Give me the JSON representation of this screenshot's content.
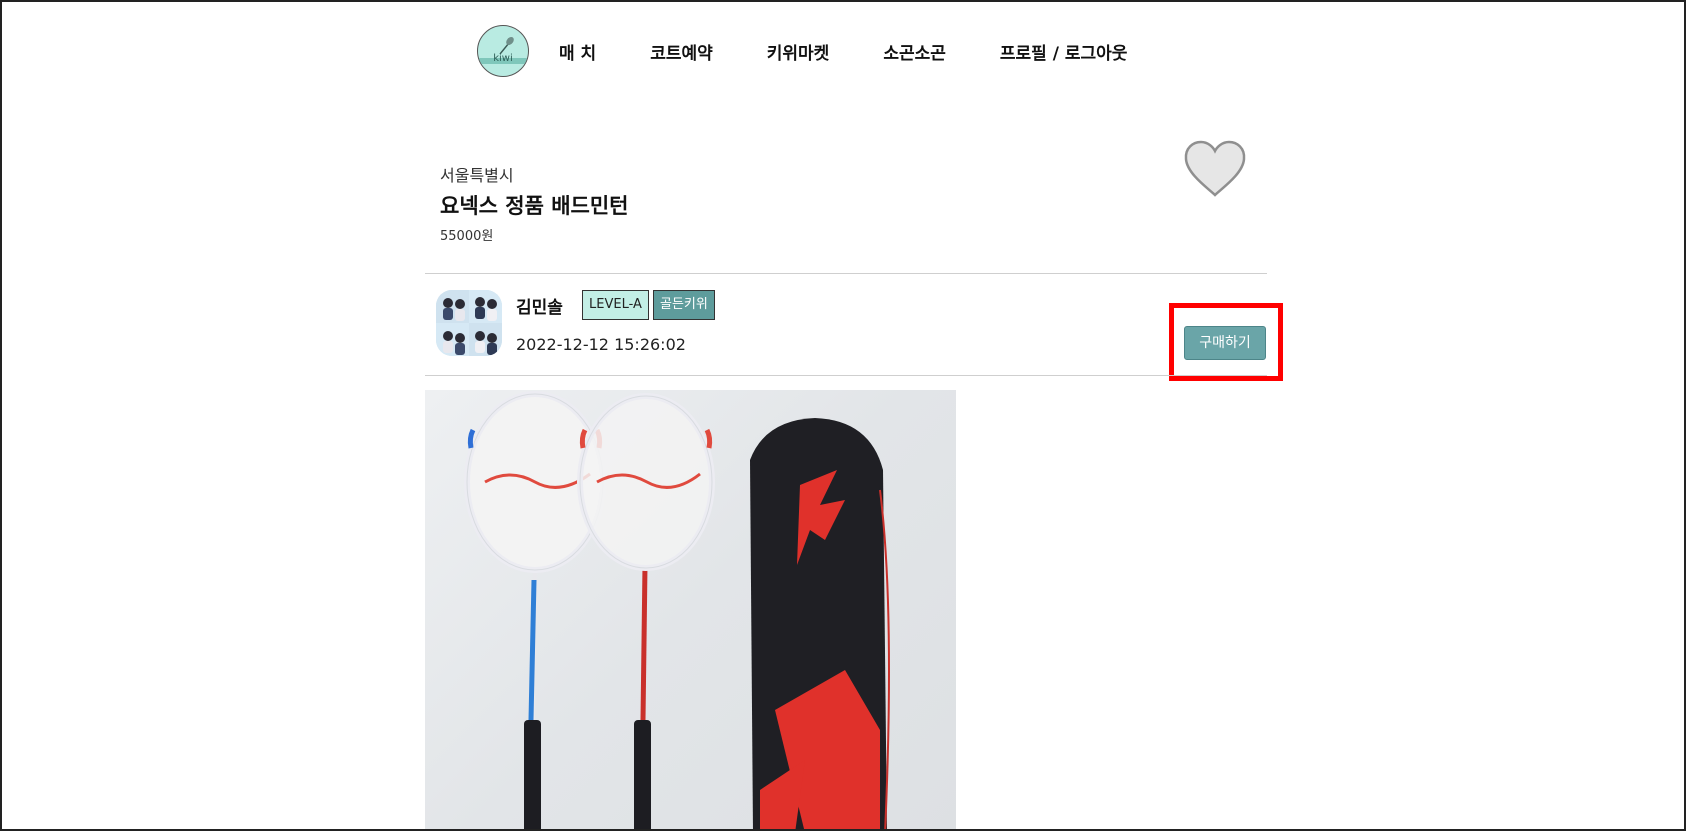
{
  "nav": {
    "logo_text": "kiwi",
    "items": [
      "매 치",
      "코트예약",
      "키위마켓",
      "소곤소곤",
      "프로필 / 로그아웃"
    ]
  },
  "product": {
    "region": "서울특별시",
    "title": "요넥스 정품 배드민턴",
    "price": "55000원"
  },
  "seller": {
    "name": "김민솔",
    "level_badge": "LEVEL-A",
    "rank_badge": "골든키위",
    "timestamp": "2022-12-12 15:26:02"
  },
  "actions": {
    "buy_label": "구매하기"
  },
  "icons": {
    "logo": "badminton-logo-icon",
    "like": "heart-icon"
  },
  "colors": {
    "accent": "#6aa5a8",
    "level_badge_bg": "#c3efe6",
    "rank_badge_bg": "#5e9c9c",
    "highlight": "#ff0000",
    "heart_fill": "#e6e6e6"
  }
}
